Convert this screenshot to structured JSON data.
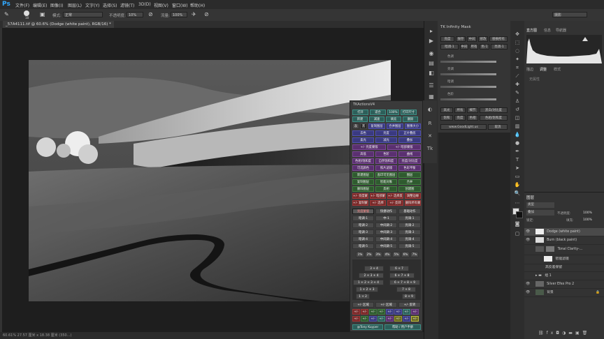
{
  "menubar": {
    "logo": "Ps",
    "items": [
      "文件(F)",
      "编辑(E)",
      "图像(I)",
      "图层(L)",
      "文字(Y)",
      "选择(S)",
      "滤镜(T)",
      "3D(D)",
      "视图(V)",
      "窗口(W)",
      "帮助(H)"
    ]
  },
  "options": {
    "brush_size": "18",
    "mode_label": "模式:",
    "mode_value": "正常",
    "opacity_label": "不透明度:",
    "opacity_value": "10%",
    "flow_label": "流量:",
    "flow_value": "100%",
    "workspace": "摄影"
  },
  "doc_tab": "_57A4111.tif @ 60.6% (Dodge (white paint), RGB/16) *",
  "status": "60.61%   27.57 厘米 x 18.38 厘米 (350...)",
  "infinity_mask": {
    "title": "TK Infinity Mask",
    "row1": [
      "亮度",
      "保存",
      "中间",
      "修改",
      "替换所有"
    ],
    "row2": [
      "暗调-1",
      "中间",
      "所有",
      "色-1",
      "亮调-1"
    ],
    "sliders": [
      "色调",
      "亮调",
      "暗调",
      "色阶"
    ],
    "row3": [
      "高光",
      "所有",
      "细节",
      "黑白/对比度"
    ],
    "row4": [
      "饱和",
      "亮度",
      "色相",
      "色相/饱和度"
    ],
    "url": "www.GoodLight.us",
    "cancel": "取消"
  },
  "tk_actions": {
    "title": "TKActionsV4",
    "top_buttons": [
      "打开",
      "适合",
      "100%",
      "打印尺寸"
    ],
    "row2": [
      "新建",
      "减速",
      "填充",
      "删除"
    ],
    "row3": [
      "灰",
      "黑",
      "复制图层",
      "合并图层",
      "图像大小"
    ],
    "row4": [
      "去色",
      "亮度",
      "正片叠底"
    ],
    "row5": [
      "柔光",
      "减光",
      "叠加"
    ],
    "row6": [
      "+/- 亮度蒙版",
      "+/- 暗部蒙版"
    ],
    "row7": [
      "高低",
      "色阶",
      "曲线"
    ],
    "row8": [
      "色相/饱和度",
      "自然饱和度",
      "亮度/对比度"
    ],
    "row9": [
      "可选颜色",
      "照片滤镜",
      "色彩平衡"
    ],
    "row10": [
      "新建图层",
      "盖印可见图层",
      "图层"
    ],
    "row11": [
      "复制图层",
      "智能对象",
      "合并"
    ],
    "row12": [
      "删除图层",
      "反相",
      "创建图"
    ],
    "row13": [
      "+/- 亮度蒙版",
      "+/- 暗部蒙版",
      "+/- 选择反相",
      "调整边缘"
    ],
    "row14": [
      "+/- 复制蒙版",
      "+/- 选择",
      "+/- 反转",
      "删除所有蒙版"
    ],
    "tabs": [
      "亮度蒙版",
      "快捷动作",
      "基础动作"
    ],
    "lum_rows": [
      [
        "暗调-1",
        "中-1",
        "亮调-1"
      ],
      [
        "暗调-2",
        "中间调-2",
        "亮调-2"
      ],
      [
        "暗调-3",
        "中间调-3",
        "亮调-3"
      ],
      [
        "暗调-4",
        "中间调-4",
        "亮调-4"
      ],
      [
        "暗调-5",
        "中间调-5",
        "亮调-5"
      ]
    ],
    "percent_row": [
      "1%",
      "2%",
      "3%",
      "4%",
      "5%",
      "6%",
      "7%"
    ],
    "zone_rows": [
      "3 + 4",
      "6 + 7",
      "2 + 3 + 4",
      "6 + 7 + 8",
      "1 + 2 + 3 + 4",
      "6 + 7 + 8 + 9",
      "7 + 8",
      "1 + 2 + 3",
      "1 + 2",
      "8 + 9"
    ],
    "bottom_row": [
      "+/- 区域",
      "+/- 区域",
      "+/- 反转"
    ],
    "footer_left": "@Tony Kuyper",
    "footer_right": "帮助 / 用户手册"
  },
  "right_panel": {
    "tabs_top": [
      "直方图",
      "信息",
      "导航器"
    ],
    "tabs_mid": [
      "描边",
      "调整",
      "样式"
    ],
    "mid_text": "无属性",
    "layers_title": "图层",
    "kind_label": "类型",
    "blend_mode": "叠加",
    "opacity_label": "不透明度:",
    "opacity_value": "100%",
    "lock_label": "锁定:",
    "fill_label": "填充:",
    "fill_value": "100%",
    "layers": [
      {
        "name": "Dodge (white paint)",
        "visible": true
      },
      {
        "name": "Burn (black paint)",
        "visible": true
      },
      {
        "name": "Tonal Clarity-...",
        "visible": false
      },
      {
        "name": "智能滤镜",
        "visible": false
      },
      {
        "name": "高反差保留",
        "visible": false
      },
      {
        "name": "组 1",
        "visible": false
      },
      {
        "name": "Silver Efex Pro 2",
        "visible": true
      },
      {
        "name": "背景",
        "visible": true
      }
    ],
    "footer_icons": [
      "link-icon",
      "fx-icon",
      "mask-icon",
      "adjust-icon",
      "folder-icon",
      "new-layer-icon",
      "trash-icon"
    ]
  }
}
